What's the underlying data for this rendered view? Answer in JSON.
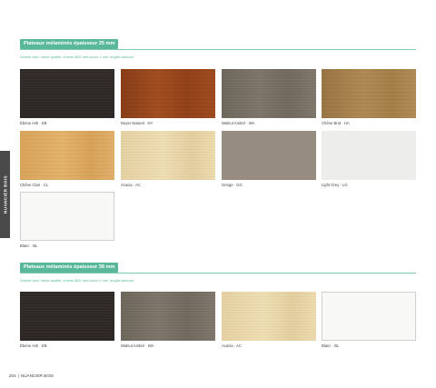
{
  "section1": {
    "title": "Plateaux mélaminés épaisseur 25 mm",
    "subtitle": "Double face, haute qualité, chants ABS anti-chocs 2 mm, angles adoucis",
    "swatches": [
      {
        "label": "Ébène Ash · EB",
        "finish": "ebene-ash",
        "color": "#2d2825"
      },
      {
        "label": "Noyer Naturel · NY",
        "finish": "noyer-naturel",
        "color": "#9a461c"
      },
      {
        "label": "Walnut Ambré · WA",
        "finish": "walnut-ambre",
        "color": "#746c61"
      },
      {
        "label": "Chêne Brut · HA",
        "finish": "chene-brut",
        "color": "#a8824d"
      },
      {
        "label": "Chêne Clair · CL",
        "finish": "chene-clair",
        "color": "#dea962"
      },
      {
        "label": "Acacia · AC",
        "finish": "acacia",
        "color": "#ead8aa"
      },
      {
        "label": "Greige · GG",
        "finish": "greige",
        "color": "#978c82"
      },
      {
        "label": "Light Grey · LG",
        "finish": "light-grey",
        "color": "#ededeb"
      },
      {
        "label": "Blanc · BL",
        "finish": "blanc",
        "color": "#f8f8f6"
      }
    ]
  },
  "section2": {
    "title": "Plateaux mélaminés épaisseur 38 mm",
    "subtitle": "Double face, haute qualité, chants ABS anti-chocs 2 mm, angles adoucis",
    "swatches": [
      {
        "label": "Ébène Ash · EB",
        "finish": "ebene-ash",
        "color": "#2d2825"
      },
      {
        "label": "Walnut Ambré · WA",
        "finish": "walnut-ambre",
        "color": "#746c61"
      },
      {
        "label": "Acacia · AC",
        "finish": "acacia",
        "color": "#ead8aa"
      },
      {
        "label": "Blanc · BL",
        "finish": "blanc",
        "color": "#f8f8f6"
      }
    ]
  },
  "side_tab": {
    "label": "NUANCIER BOIS"
  },
  "footer": {
    "page_number": "204",
    "separator": "|",
    "label": "NUANCIER BOIS"
  },
  "colors": {
    "accent": "#59b79a",
    "side_tab": "#4a4a4a"
  }
}
